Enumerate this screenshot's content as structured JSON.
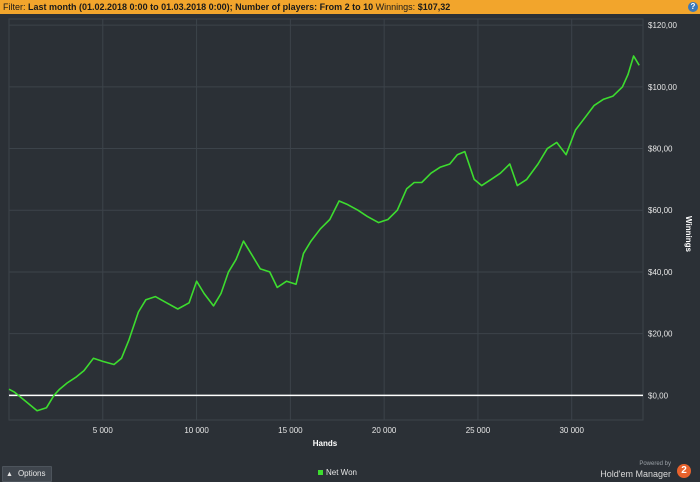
{
  "filter": {
    "label": "Filter:",
    "text": "Last month (01.02.2018 0:00 to 01.03.2018 0:00); Number of players: From 2 to 10",
    "winnings_label": "Winnings:",
    "winnings_value": "$107,32"
  },
  "help_icon": "help-icon",
  "colors": {
    "filter_bar": "#f2a52c",
    "background": "#2b3036",
    "series": "#3ddc2f",
    "zero_line": "#ffffff",
    "badge": "#e8622c"
  },
  "chart_data": {
    "type": "line",
    "xlabel": "Hands",
    "ylabel": "Winnings",
    "xlim": [
      0,
      33800
    ],
    "ylim": [
      -8,
      122
    ],
    "x_ticks": [
      5000,
      10000,
      15000,
      20000,
      25000,
      30000
    ],
    "x_tick_labels": [
      "5 000",
      "10 000",
      "15 000",
      "20 000",
      "25 000",
      "30 000"
    ],
    "y_ticks": [
      0,
      20,
      40,
      60,
      80,
      100,
      120
    ],
    "y_tick_labels": [
      "$0,00",
      "$20,00",
      "$40,00",
      "$60,00",
      "$80,00",
      "$100,00",
      "$120,00"
    ],
    "grid": true,
    "y_axis_side": "right",
    "legend_position": "bottom-center",
    "series": [
      {
        "name": "Net Won",
        "x": [
          0,
          300,
          900,
          1500,
          2000,
          2400,
          2700,
          3100,
          3600,
          4000,
          4500,
          5000,
          5600,
          6000,
          6400,
          6900,
          7300,
          7800,
          8400,
          9000,
          9600,
          10000,
          10400,
          10900,
          11300,
          11700,
          12100,
          12500,
          12900,
          13400,
          13900,
          14300,
          14800,
          15300,
          15700,
          16100,
          16600,
          17100,
          17600,
          18000,
          18600,
          19100,
          19700,
          20200,
          20700,
          21200,
          21600,
          22000,
          22500,
          23000,
          23500,
          23900,
          24300,
          24800,
          25200,
          25700,
          26200,
          26700,
          27100,
          27600,
          28200,
          28700,
          29200,
          29700,
          30200,
          30700,
          31200,
          31700,
          32200,
          32700,
          33000,
          33300,
          33600
        ],
        "y": [
          2,
          1,
          -2,
          -5,
          -4,
          0,
          2,
          4,
          6,
          8,
          12,
          11,
          10,
          12,
          18,
          27,
          31,
          32,
          30,
          28,
          30,
          37,
          33,
          29,
          33,
          40,
          44,
          50,
          46,
          41,
          40,
          35,
          37,
          36,
          46,
          50,
          54,
          57,
          63,
          62,
          60,
          58,
          56,
          57,
          60,
          67,
          69,
          69,
          72,
          74,
          75,
          78,
          79,
          70,
          68,
          70,
          72,
          75,
          68,
          70,
          75,
          80,
          82,
          78,
          86,
          90,
          94,
          96,
          97,
          100,
          104,
          110,
          107
        ]
      }
    ]
  },
  "footer": {
    "options_label": "Options",
    "legend_label": "Net Won",
    "powered_by": "Powered by",
    "brand_name": "Hold'em Manager",
    "brand_badge": "2"
  }
}
